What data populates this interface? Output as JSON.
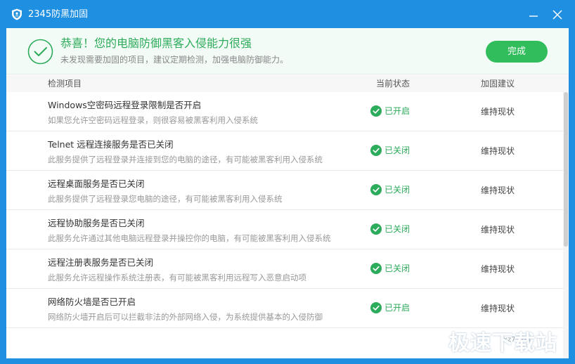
{
  "window": {
    "title": "2345防黑加固",
    "accent": "#1e8fe1",
    "success_color": "#2cab5a"
  },
  "banner": {
    "title": "恭喜！您的电脑防御黑客入侵能力很强",
    "subtitle": "未发现需要加固的项目，建议定期检测，加强电脑防御能力。",
    "done_label": "完成",
    "icon": "check-circle-icon"
  },
  "table": {
    "headers": {
      "item": "检测项目",
      "status": "当前状态",
      "advice": "加固建议"
    },
    "rows": [
      {
        "title": "Windows空密码远程登录限制是否开启",
        "desc": "如果您允许空密码远程登录，则很容易被黑客利用入侵系统",
        "status": "已开启",
        "advice": "维持现状"
      },
      {
        "title": "Telnet 远程连接服务是否已关闭",
        "desc": "此服务提供了远程登录并连接到您的电脑的途径，有可能被黑客利用入侵系统",
        "status": "已关闭",
        "advice": "维持现状"
      },
      {
        "title": "远程桌面服务是否已关闭",
        "desc": "此服务提供了远程登录您电脑的途径，有可能被黑客利用入侵系统",
        "status": "已关闭",
        "advice": "维持现状"
      },
      {
        "title": "远程协助服务是否已关闭",
        "desc": "此服务允许通过其他电脑远程登录并操控你的电脑，有可能被黑客利用入侵系统",
        "status": "已关闭",
        "advice": "维持现状"
      },
      {
        "title": "远程注册表服务是否已关闭",
        "desc": "此服务允许远程操作系统注册表，有可能被黑客利用远程写入恶意启动项",
        "status": "已关闭",
        "advice": "维持现状"
      },
      {
        "title": "网络防火墙是否已开启",
        "desc": "网络防火墙开启后可以拦截非法的外部网络入侵，为系统提供基本的入侵防御",
        "status": "已开启",
        "advice": "维持现状"
      }
    ]
  },
  "watermark": {
    "text": "极速下载站",
    "small": "xz7.com"
  }
}
